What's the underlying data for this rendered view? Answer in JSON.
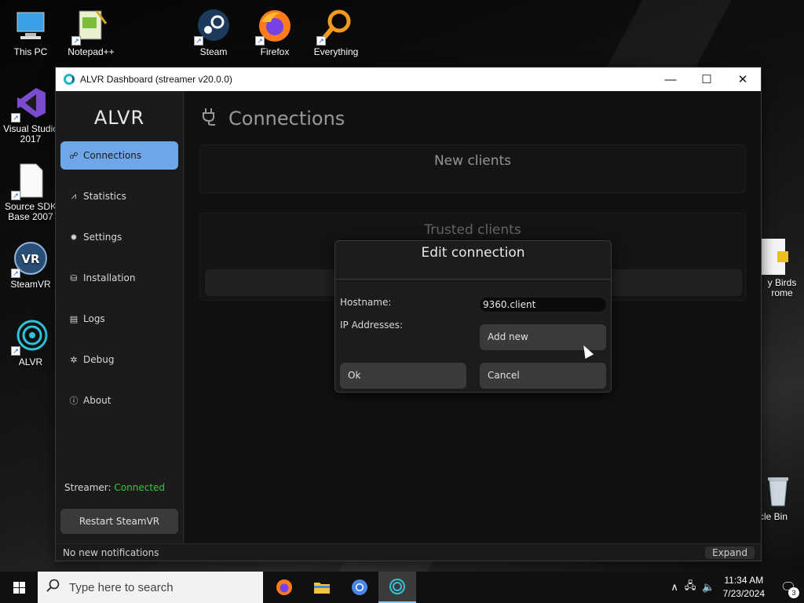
{
  "desktop": {
    "icons": [
      {
        "label": "This PC",
        "icon": "computer-icon"
      },
      {
        "label": "Notepad++",
        "icon": "notepad-icon"
      },
      {
        "label": "Steam",
        "icon": "steam-icon"
      },
      {
        "label": "Firefox",
        "icon": "firefox-icon"
      },
      {
        "label": "Everything",
        "icon": "search-app-icon"
      },
      {
        "label": "Visual Studio 2017",
        "icon": "visual-studio-icon"
      },
      {
        "label": "Source SDK Base 2007",
        "icon": "file-icon"
      },
      {
        "label": "SteamVR",
        "icon": "steamvr-icon"
      },
      {
        "label": "ALVR",
        "icon": "alvr-icon"
      },
      {
        "label": "y Birds rome",
        "icon": "app-icon"
      },
      {
        "label": "cle Bin",
        "icon": "recycle-bin-icon"
      }
    ]
  },
  "window": {
    "title": "ALVR Dashboard (streamer v20.0.0)",
    "controls": {
      "minimize": "—",
      "maximize": "☐",
      "close": "✕"
    }
  },
  "sidebar": {
    "brand": "ALVR",
    "items": [
      {
        "label": "Connections",
        "icon": "plug-icon",
        "glyph": "☍",
        "active": true
      },
      {
        "label": "Statistics",
        "icon": "chart-icon",
        "glyph": "⩘"
      },
      {
        "label": "Settings",
        "icon": "gear-icon",
        "glyph": "✹"
      },
      {
        "label": "Installation",
        "icon": "box-icon",
        "glyph": "⛁"
      },
      {
        "label": "Logs",
        "icon": "scroll-icon",
        "glyph": "▤"
      },
      {
        "label": "Debug",
        "icon": "bug-icon",
        "glyph": "✲"
      },
      {
        "label": "About",
        "icon": "info-icon",
        "glyph": "ⓘ"
      }
    ],
    "streamer_label": "Streamer:",
    "streamer_status": "Connected",
    "restart_label": "Restart SteamVR"
  },
  "main": {
    "page_title": "Connections",
    "new_clients_title": "New clients",
    "trusted_clients_title": "Trusted clients"
  },
  "dialog": {
    "title": "Edit connection",
    "hostname_label": "Hostname:",
    "hostname_value": "9360.client",
    "ip_label": "IP Addresses:",
    "add_new_label": "Add new",
    "ok_label": "Ok",
    "cancel_label": "Cancel"
  },
  "statusbar": {
    "message": "No new notifications",
    "expand_label": "Expand"
  },
  "taskbar": {
    "search_placeholder": "Type here to search",
    "time": "11:34 AM",
    "date": "7/23/2024",
    "notification_count": "3"
  },
  "colors": {
    "accent": "#6ea6e8",
    "connected": "#3ec43e"
  }
}
